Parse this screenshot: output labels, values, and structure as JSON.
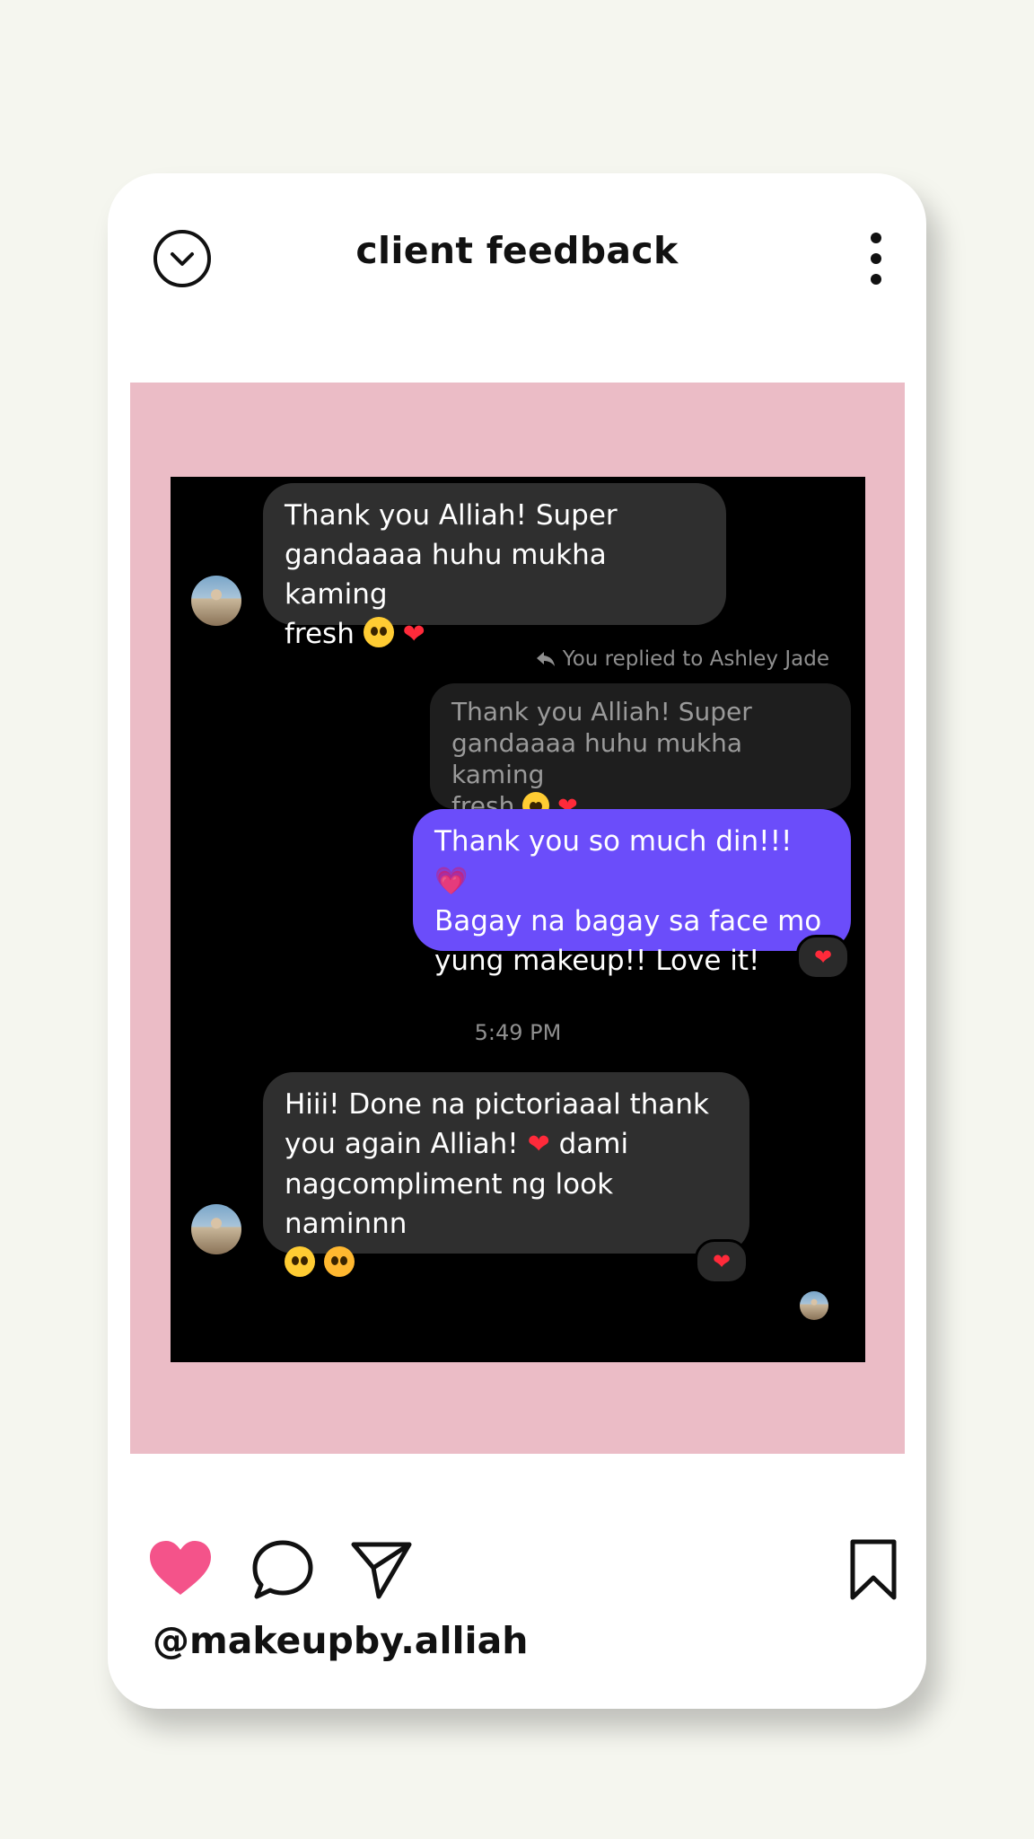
{
  "post": {
    "title": "client feedback",
    "handle": "@makeupby.alliah"
  },
  "chat": {
    "messages": [
      {
        "line1": "Thank you Alliah! Super",
        "line2": "gandaaaa huhu mukha kaming",
        "line3": "fresh"
      },
      {
        "reply_note": "You replied to Ashley Jade"
      },
      {
        "quote_line1": "Thank you Alliah! Super",
        "quote_line2": "gandaaaa huhu mukha kaming",
        "quote_line3": "fresh"
      },
      {
        "line1": "Thank you so much din!!!",
        "line2": "Bagay na bagay sa face mo",
        "line3": "yung makeup!! Love it!"
      },
      {
        "line1": "Hiii! Done na pictoriaaal thank",
        "line2": "you again Alliah!",
        "line2b": "dami",
        "line3": "nagcompliment ng look naminnn"
      }
    ],
    "timestamp": "5:49 PM",
    "emoji": {
      "heart": "❤",
      "sparkle_heart": "💗"
    }
  },
  "icons": {
    "collapse": "chevron-down-circle-icon",
    "more": "more-vertical-icon",
    "like": "heart-icon",
    "comment": "comment-icon",
    "share": "send-icon",
    "save": "bookmark-icon"
  },
  "colors": {
    "background": "#f5f6ef",
    "frame": "#ebbcc6",
    "sent_bubble": "#6b4dfa",
    "received_bubble": "#2f2f2f",
    "like": "#f4538a"
  }
}
